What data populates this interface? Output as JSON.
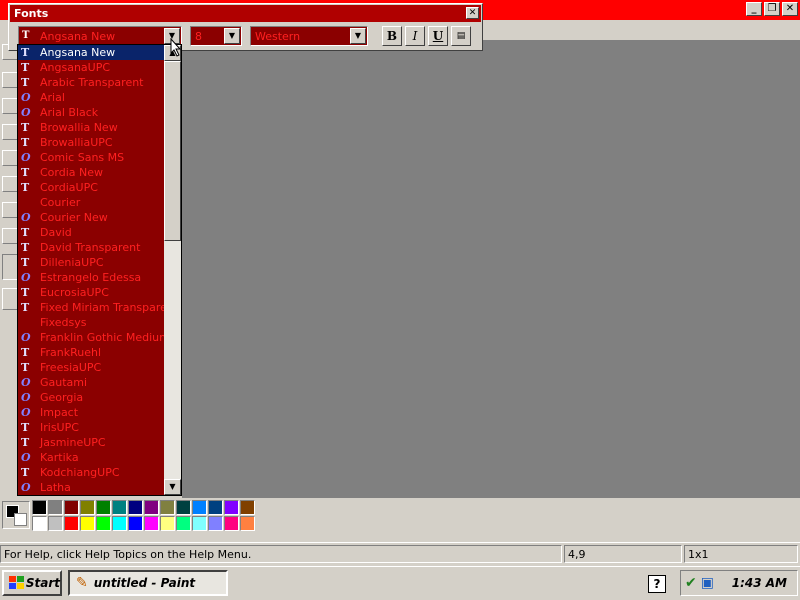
{
  "app": {
    "taskbar_title": "untitled - Paint"
  },
  "fonts_toolbar": {
    "title": "Fonts",
    "font_name": "Angsana New",
    "font_size": "8",
    "script": "Western",
    "bold_label": "B",
    "italic_label": "I",
    "underline_label": "U"
  },
  "font_list": {
    "items": [
      {
        "label": "Angsana New",
        "icon": "truetype-icon",
        "selected": true
      },
      {
        "label": "AngsanaUPC",
        "icon": "truetype-icon"
      },
      {
        "label": "Arabic Transparent",
        "icon": "truetype-icon"
      },
      {
        "label": "Arial",
        "icon": "opentype-icon"
      },
      {
        "label": "Arial Black",
        "icon": "opentype-icon"
      },
      {
        "label": "Browallia New",
        "icon": "truetype-icon"
      },
      {
        "label": "BrowalliaUPC",
        "icon": "truetype-icon"
      },
      {
        "label": "Comic Sans MS",
        "icon": "opentype-icon"
      },
      {
        "label": "Cordia New",
        "icon": "truetype-icon"
      },
      {
        "label": "CordiaUPC",
        "icon": "truetype-icon"
      },
      {
        "label": "Courier",
        "icon": "none"
      },
      {
        "label": "Courier New",
        "icon": "opentype-icon"
      },
      {
        "label": "David",
        "icon": "truetype-icon"
      },
      {
        "label": "David Transparent",
        "icon": "truetype-icon"
      },
      {
        "label": "DilleniaUPC",
        "icon": "truetype-icon"
      },
      {
        "label": "Estrangelo Edessa",
        "icon": "opentype-icon"
      },
      {
        "label": "EucrosiaUPC",
        "icon": "truetype-icon"
      },
      {
        "label": "Fixed Miriam Transparent",
        "icon": "truetype-icon"
      },
      {
        "label": "Fixedsys",
        "icon": "none"
      },
      {
        "label": "Franklin Gothic Medium",
        "icon": "opentype-icon"
      },
      {
        "label": "FrankRuehl",
        "icon": "truetype-icon"
      },
      {
        "label": "FreesiaUPC",
        "icon": "truetype-icon"
      },
      {
        "label": "Gautami",
        "icon": "opentype-icon"
      },
      {
        "label": "Georgia",
        "icon": "opentype-icon"
      },
      {
        "label": "Impact",
        "icon": "opentype-icon"
      },
      {
        "label": "IrisUPC",
        "icon": "truetype-icon"
      },
      {
        "label": "JasmineUPC",
        "icon": "truetype-icon"
      },
      {
        "label": "Kartika",
        "icon": "opentype-icon"
      },
      {
        "label": "KodchiangUPC",
        "icon": "truetype-icon"
      },
      {
        "label": "Latha",
        "icon": "opentype-icon"
      }
    ]
  },
  "palette": {
    "row1": [
      "#000000",
      "#808080",
      "#800000",
      "#808000",
      "#008000",
      "#008080",
      "#000080",
      "#800080",
      "#808040",
      "#004040",
      "#0080ff",
      "#004080",
      "#8000ff",
      "#804000"
    ],
    "row2": [
      "#ffffff",
      "#c0c0c0",
      "#ff0000",
      "#ffff00",
      "#00ff00",
      "#00ffff",
      "#0000ff",
      "#ff00ff",
      "#ffff80",
      "#00ff80",
      "#80ffff",
      "#8080ff",
      "#ff0080",
      "#ff8040"
    ]
  },
  "statusbar": {
    "help": "For Help, click Help Topics on the Help Menu.",
    "coords": "4,9",
    "size": "1x1"
  },
  "taskbar": {
    "start_label": "Start",
    "help_label": "?",
    "clock": "1:43 AM"
  },
  "colors": {
    "title_red": "#ff0000",
    "list_bg": "#8b0000",
    "list_text": "#ff2020",
    "selection": "#0a246a"
  }
}
